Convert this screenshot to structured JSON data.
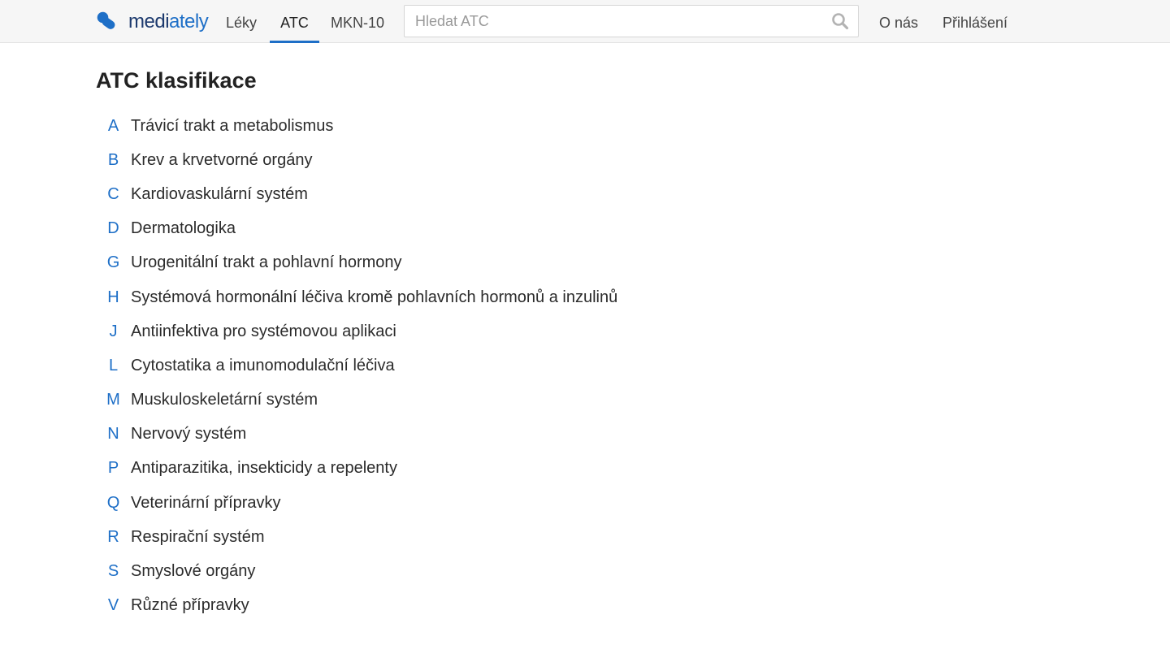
{
  "brand": {
    "logo_prefix": "medi",
    "logo_suffix": "ately",
    "accent_color": "#1e6fc7"
  },
  "nav": {
    "items": [
      {
        "label": "Léky",
        "active": false
      },
      {
        "label": "ATC",
        "active": true
      },
      {
        "label": "MKN-10",
        "active": false
      }
    ],
    "right_items": [
      {
        "label": "O nás"
      },
      {
        "label": "Přihlášení"
      }
    ]
  },
  "search": {
    "placeholder": "Hledat ATC",
    "value": "",
    "icon": "search-icon"
  },
  "page": {
    "title": "ATC klasifikace"
  },
  "atc_groups": [
    {
      "code": "A",
      "name": "Trávicí trakt a metabolismus"
    },
    {
      "code": "B",
      "name": "Krev a krvetvorné orgány"
    },
    {
      "code": "C",
      "name": "Kardiovaskulární systém"
    },
    {
      "code": "D",
      "name": "Dermatologika"
    },
    {
      "code": "G",
      "name": "Urogenitální trakt a pohlavní hormony"
    },
    {
      "code": "H",
      "name": "Systémová hormonální léčiva kromě pohlavních hormonů a inzulinů"
    },
    {
      "code": "J",
      "name": "Antiinfektiva pro systémovou aplikaci"
    },
    {
      "code": "L",
      "name": "Cytostatika a imunomodulační léčiva"
    },
    {
      "code": "M",
      "name": "Muskuloskeletární systém"
    },
    {
      "code": "N",
      "name": "Nervový systém"
    },
    {
      "code": "P",
      "name": "Antiparazitika, insekticidy a repelenty"
    },
    {
      "code": "Q",
      "name": "Veterinární přípravky"
    },
    {
      "code": "R",
      "name": "Respirační systém"
    },
    {
      "code": "S",
      "name": "Smyslové orgány"
    },
    {
      "code": "V",
      "name": "Různé přípravky"
    }
  ]
}
